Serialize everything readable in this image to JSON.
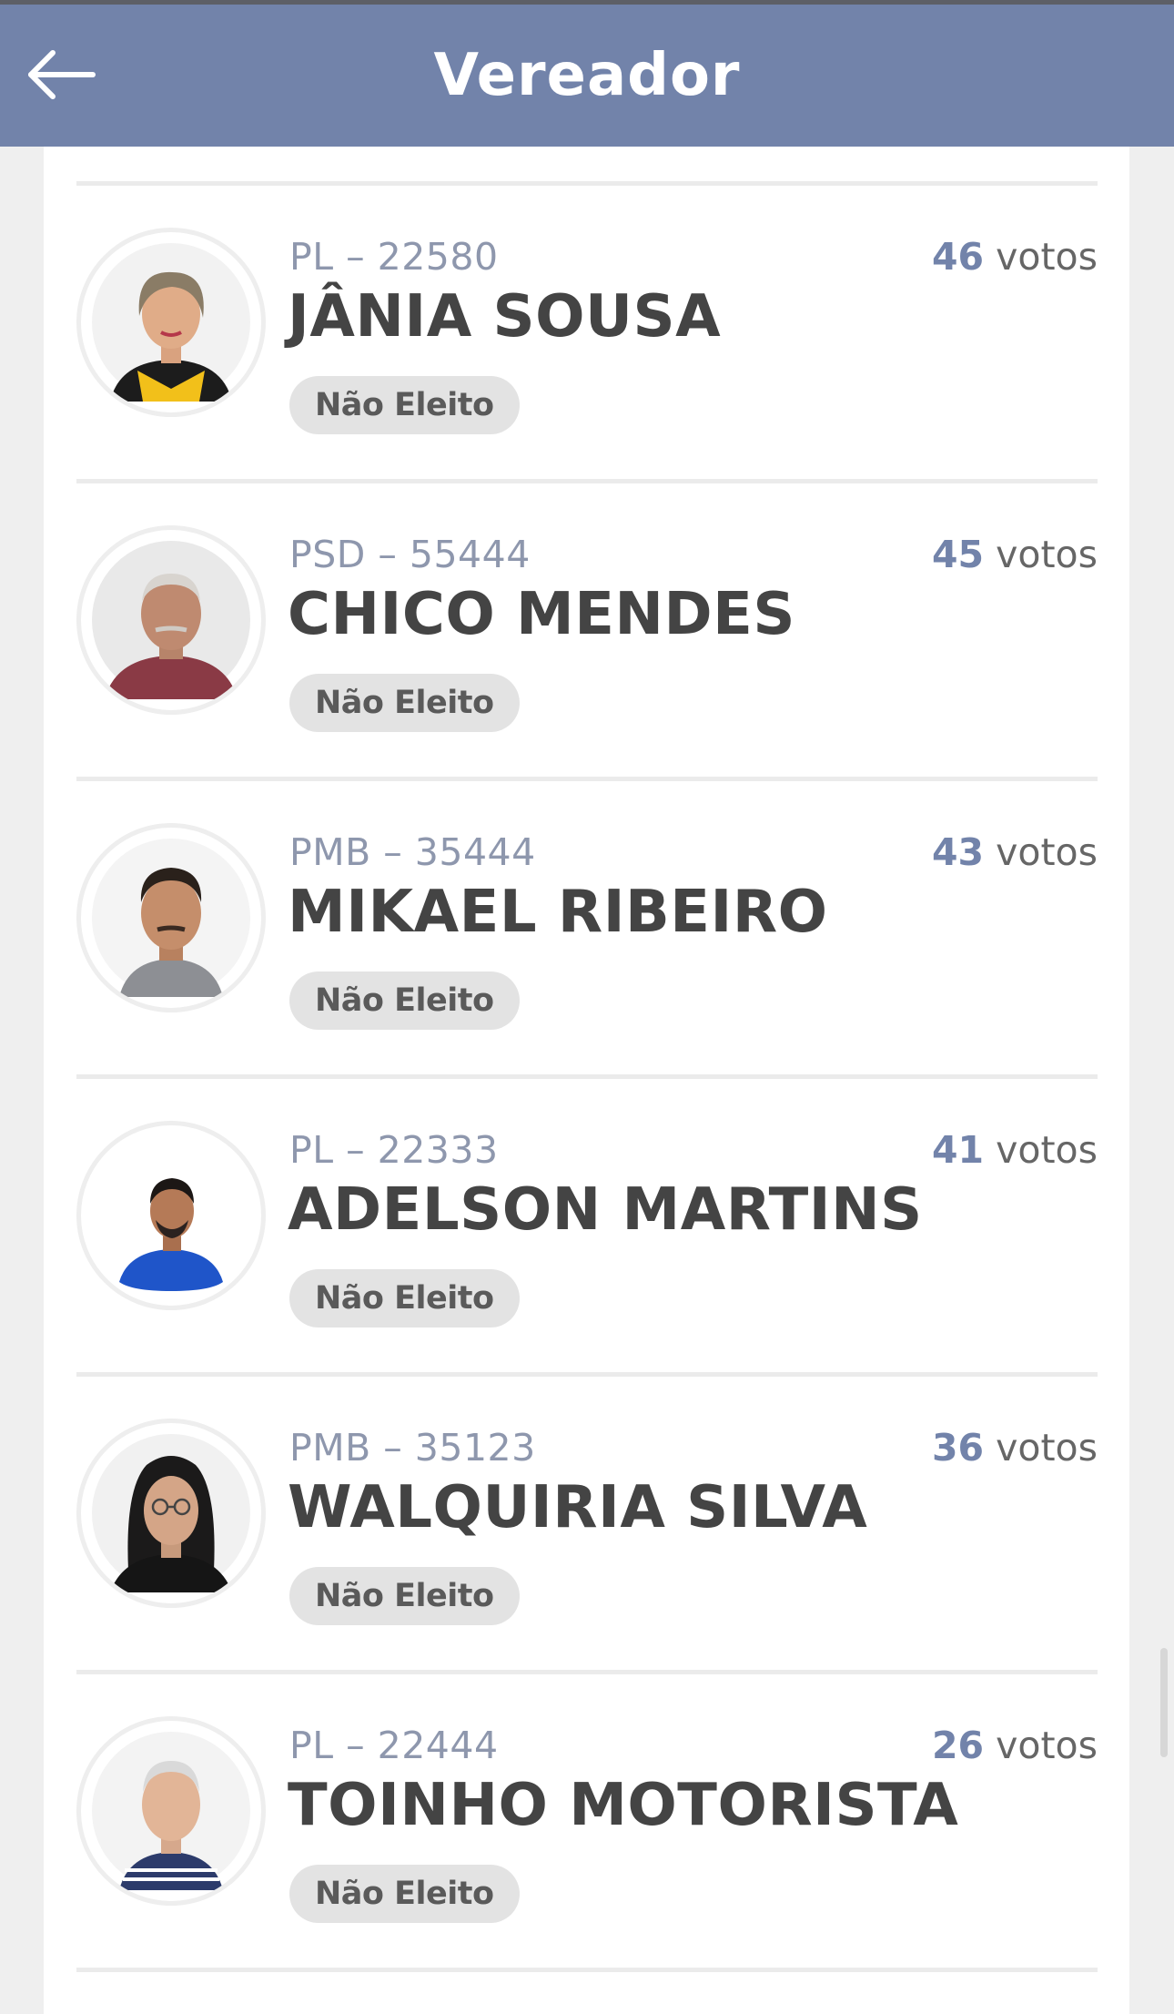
{
  "header": {
    "title": "Vereador",
    "back_icon": "arrow-left-icon",
    "background": "#7283aa"
  },
  "candidates": [
    {
      "party": "PL – 22580",
      "name": "JÂNIA SOUSA",
      "votes": "46",
      "votes_label": "votos",
      "status": "Não Eleito",
      "photo": "woman-yellow-blazer"
    },
    {
      "party": "PSD – 55444",
      "name": "CHICO MENDES",
      "votes": "45",
      "votes_label": "votos",
      "status": "Não Eleito",
      "photo": "older-man-red-shirt"
    },
    {
      "party": "PMB – 35444",
      "name": "MIKAEL RIBEIRO",
      "votes": "43",
      "votes_label": "votos",
      "status": "Não Eleito",
      "photo": "man-gray-shirt"
    },
    {
      "party": "PL – 22333",
      "name": "ADELSON MARTINS",
      "votes": "41",
      "votes_label": "votos",
      "status": "Não Eleito",
      "photo": "man-blue-shirt"
    },
    {
      "party": "PMB – 35123",
      "name": "WALQUIRIA SILVA",
      "votes": "36",
      "votes_label": "votos",
      "status": "Não Eleito",
      "photo": "woman-glasses"
    },
    {
      "party": "PL – 22444",
      "name": "TOINHO MOTORISTA",
      "votes": "26",
      "votes_label": "votos",
      "status": "Não Eleito",
      "photo": "older-man-striped-shirt"
    }
  ],
  "colors": {
    "accent": "#7283aa",
    "badge_bg": "#e3e3e3",
    "name_text": "#444444"
  }
}
